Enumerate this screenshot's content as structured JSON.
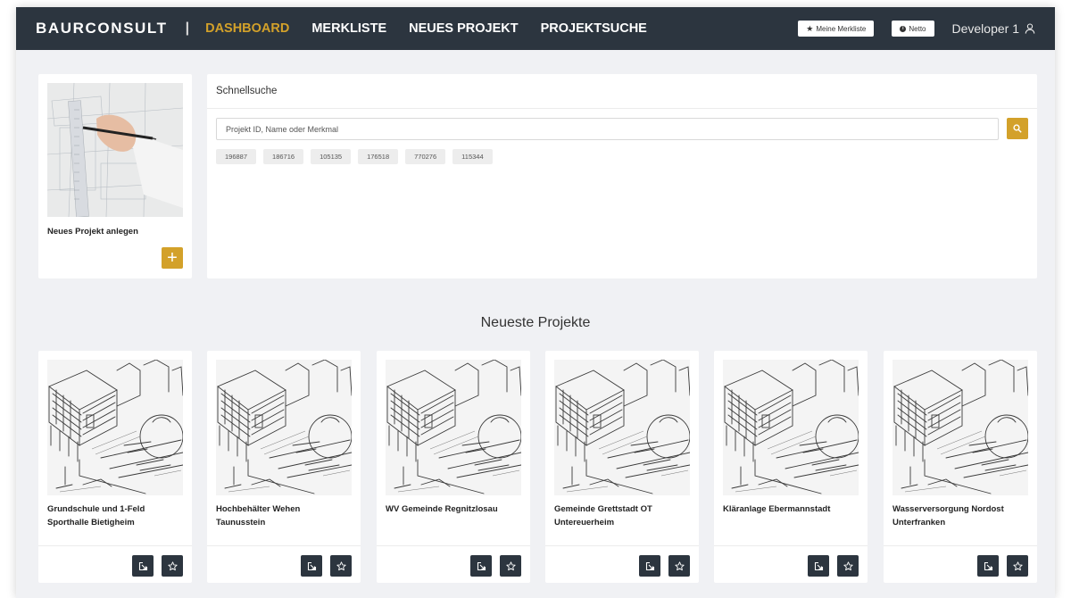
{
  "brand": "BAURCONSULT",
  "nav": {
    "separator": "|",
    "items": [
      "DASHBOARD",
      "MERKLISTE",
      "NEUES PROJEKT",
      "PROJEKTSUCHE"
    ],
    "active_index": 0
  },
  "header_actions": {
    "merkliste_label": "Meine Merkliste",
    "netto_label": "Netto",
    "info_glyph": "i",
    "user_name": "Developer 1"
  },
  "new_project": {
    "label": "Neues Projekt anlegen",
    "add_symbol": "+"
  },
  "quick_search": {
    "title": "Schnellsuche",
    "placeholder": "Projekt ID, Name oder Merkmal",
    "recent_ids": [
      "196887",
      "186716",
      "105135",
      "176518",
      "770276",
      "115344"
    ]
  },
  "latest": {
    "title": "Neueste Projekte",
    "projects": [
      {
        "name": "Grundschule und 1-Feld Sporthalle Bietigheim"
      },
      {
        "name": "Hochbehälter Wehen Taunusstein"
      },
      {
        "name": "WV Gemeinde Regnitzlosau"
      },
      {
        "name": "Gemeinde Grettstadt OT Untereuerheim"
      },
      {
        "name": "Kläranlage Ebermannstadt"
      },
      {
        "name": "Wasserversorgung Nordost Unterfranken"
      }
    ]
  },
  "icons": {
    "merkliste": "star-icon",
    "netto": "info-icon",
    "user": "user-icon",
    "search": "search-icon",
    "open": "open-external-icon",
    "favorite": "star-outline-icon"
  },
  "colors": {
    "navbar": "#2c353f",
    "accent": "#d3a12a",
    "page": "#f0f1f4"
  }
}
